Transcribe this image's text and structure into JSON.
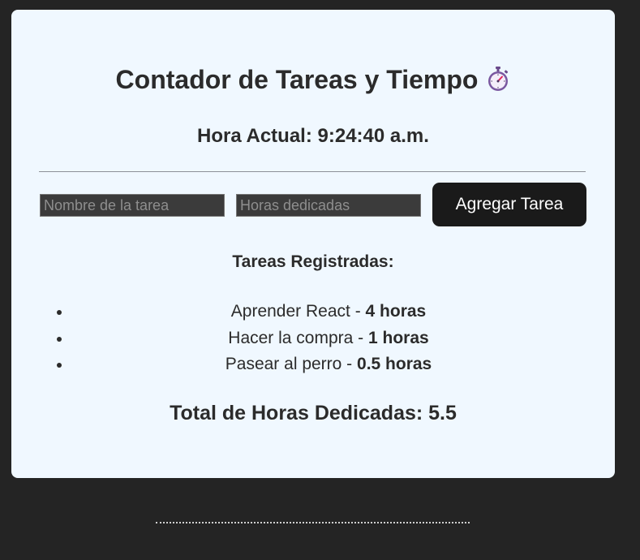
{
  "header": {
    "title": "Contador de Tareas y Tiempo",
    "icon": "stopwatch-icon"
  },
  "clock": {
    "label": "Hora Actual: 9:24:40 a.m."
  },
  "form": {
    "task_placeholder": "Nombre de la tarea",
    "task_value": "",
    "hours_placeholder": "Horas dedicadas",
    "hours_value": "",
    "add_button_label": "Agregar Tarea"
  },
  "tasks": {
    "heading": "Tareas Registradas:",
    "items": [
      {
        "name": "Aprender React",
        "separator": " - ",
        "hours": "4 horas"
      },
      {
        "name": "Hacer la compra",
        "separator": " - ",
        "hours": "1 horas"
      },
      {
        "name": "Pasear al perro",
        "separator": " - ",
        "hours": "0.5 horas"
      }
    ]
  },
  "summary": {
    "total_label": "Total de Horas Dedicadas: 5.5"
  },
  "colors": {
    "page_background": "#242424",
    "card_background": "#f0f8ff",
    "button_background": "#1a1a1a",
    "text": "#2b2b2b"
  }
}
